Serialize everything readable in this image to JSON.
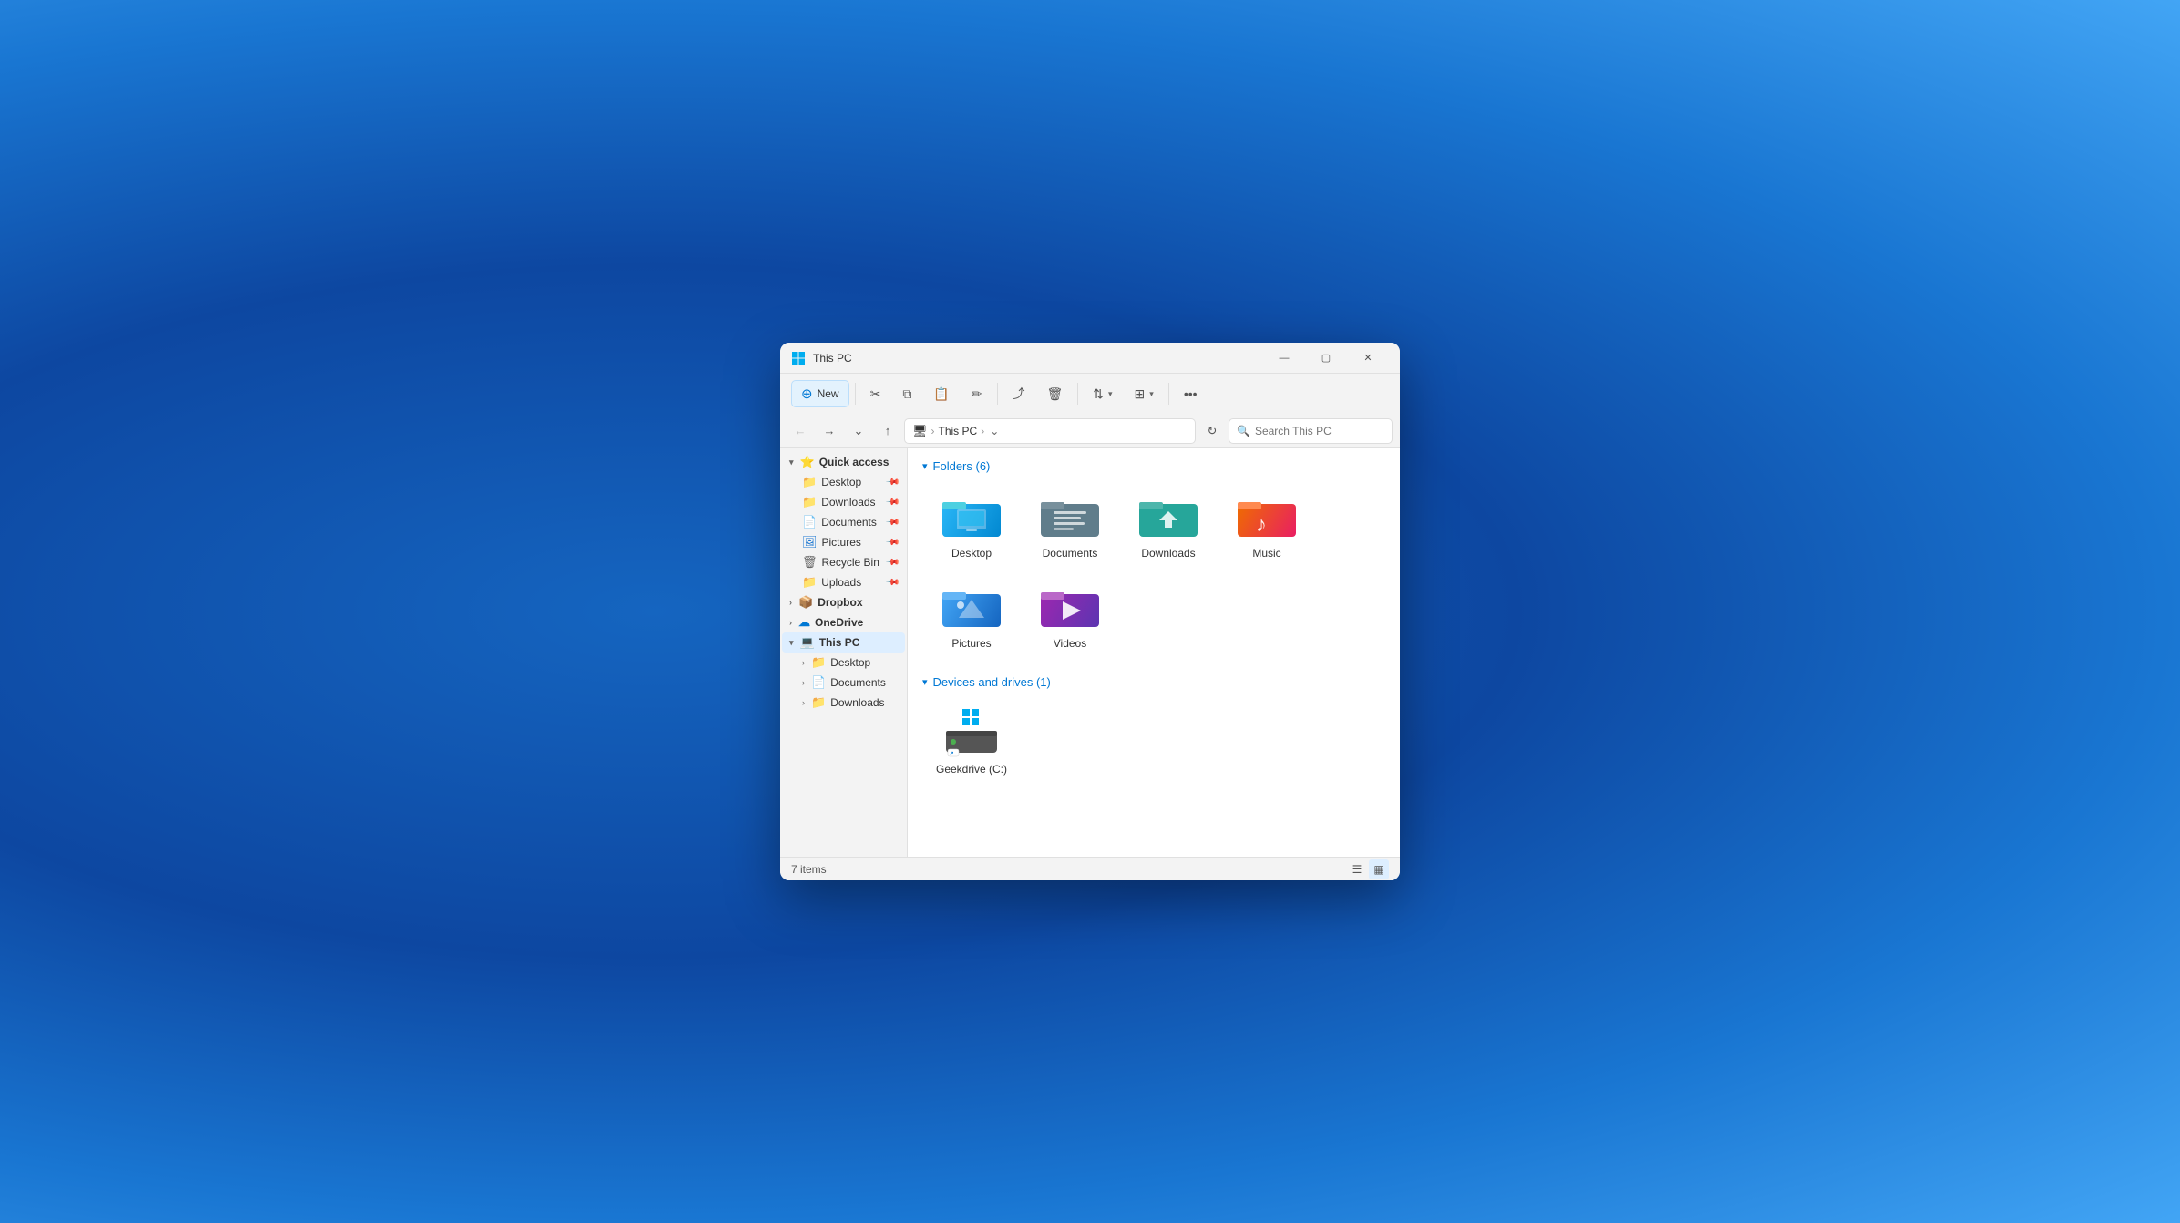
{
  "window": {
    "title": "This PC",
    "titlebar_icon": "💻"
  },
  "toolbar": {
    "new_label": "New",
    "buttons": [
      {
        "id": "cut",
        "icon": "✂",
        "label": "Cut"
      },
      {
        "id": "copy",
        "icon": "⧉",
        "label": "Copy"
      },
      {
        "id": "paste",
        "icon": "📋",
        "label": "Paste"
      },
      {
        "id": "rename",
        "icon": "✏",
        "label": "Rename"
      },
      {
        "id": "share",
        "icon": "⤴",
        "label": "Share"
      },
      {
        "id": "delete",
        "icon": "🗑",
        "label": "Delete"
      },
      {
        "id": "sort",
        "icon": "⇅",
        "label": "Sort"
      },
      {
        "id": "view",
        "icon": "⊞",
        "label": "View"
      },
      {
        "id": "more",
        "icon": "…",
        "label": "More"
      }
    ]
  },
  "address_bar": {
    "breadcrumbs": [
      "🖥",
      "This PC"
    ],
    "search_placeholder": "Search This PC",
    "refresh_icon": "↻"
  },
  "sidebar": {
    "sections": [
      {
        "id": "quick-access",
        "label": "Quick access",
        "expanded": true,
        "icon": "⭐",
        "items": [
          {
            "id": "desktop",
            "label": "Desktop",
            "icon": "🖥",
            "pinned": true
          },
          {
            "id": "downloads",
            "label": "Downloads",
            "icon": "⬇",
            "pinned": true
          },
          {
            "id": "documents",
            "label": "Documents",
            "icon": "📄",
            "pinned": true
          },
          {
            "id": "pictures",
            "label": "Pictures",
            "icon": "🖼",
            "pinned": true
          },
          {
            "id": "recycle-bin",
            "label": "Recycle Bin",
            "icon": "🗑",
            "pinned": true
          },
          {
            "id": "uploads",
            "label": "Uploads",
            "icon": "📁",
            "pinned": true
          }
        ]
      },
      {
        "id": "dropbox",
        "label": "Dropbox",
        "icon": "📦",
        "expanded": false,
        "items": []
      },
      {
        "id": "onedrive",
        "label": "OneDrive",
        "icon": "☁",
        "expanded": false,
        "items": []
      },
      {
        "id": "this-pc",
        "label": "This PC",
        "icon": "💻",
        "expanded": true,
        "items": [
          {
            "id": "desktop2",
            "label": "Desktop",
            "icon": "🖥"
          },
          {
            "id": "documents2",
            "label": "Documents",
            "icon": "📄"
          },
          {
            "id": "downloads2",
            "label": "Downloads",
            "icon": "⬇"
          }
        ]
      }
    ]
  },
  "file_area": {
    "folders_section": {
      "title": "Folders (6)",
      "folders": [
        {
          "id": "desktop",
          "label": "Desktop",
          "color": "#29b6f6",
          "type": "desktop"
        },
        {
          "id": "documents",
          "label": "Documents",
          "color": "#546e7a",
          "type": "documents"
        },
        {
          "id": "downloads",
          "label": "Downloads",
          "color": "#26a69a",
          "type": "downloads"
        },
        {
          "id": "music",
          "label": "Music",
          "color": "#ef6c00",
          "type": "music"
        },
        {
          "id": "pictures",
          "label": "Pictures",
          "color": "#42a5f5",
          "type": "pictures"
        },
        {
          "id": "videos",
          "label": "Videos",
          "color": "#7e57c2",
          "type": "videos"
        }
      ]
    },
    "drives_section": {
      "title": "Devices and drives (1)",
      "drives": [
        {
          "id": "c-drive",
          "label": "Geekdrive (C:)",
          "type": "hdd"
        }
      ]
    }
  },
  "status_bar": {
    "item_count": "7 items"
  }
}
